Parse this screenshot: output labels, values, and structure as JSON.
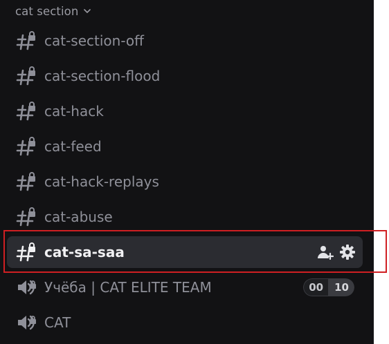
{
  "category": {
    "label": "cat section"
  },
  "channels": [
    {
      "name": "cat-section-off",
      "icon": "locked-hashtag-icon"
    },
    {
      "name": "cat-section-flood",
      "icon": "locked-hashtag-icon"
    },
    {
      "name": "cat-hack",
      "icon": "locked-hashtag-icon"
    },
    {
      "name": "cat-feed",
      "icon": "locked-hashtag-icon"
    },
    {
      "name": "cat-hack-replays",
      "icon": "locked-hashtag-icon"
    },
    {
      "name": "cat-abuse",
      "icon": "locked-hashtag-icon"
    },
    {
      "name": "cat-sa-saa",
      "icon": "locked-hashtag-icon",
      "selected": true
    },
    {
      "name": "Учёба | CAT ELITE TEAM",
      "icon": "locked-voice-icon"
    },
    {
      "name": "CAT",
      "icon": "locked-voice-icon"
    }
  ],
  "selected_actions": {
    "invite_icon": "invite-member-icon",
    "settings_icon": "gear-icon"
  },
  "voice_counter": {
    "current": "00",
    "limit": "10"
  },
  "colors": {
    "sidebar_bg": "#121214",
    "text_muted": "#8f9099",
    "text_selected": "#f1f1f3",
    "selected_bg": "#2b2c31",
    "highlight": "#d01f22"
  }
}
